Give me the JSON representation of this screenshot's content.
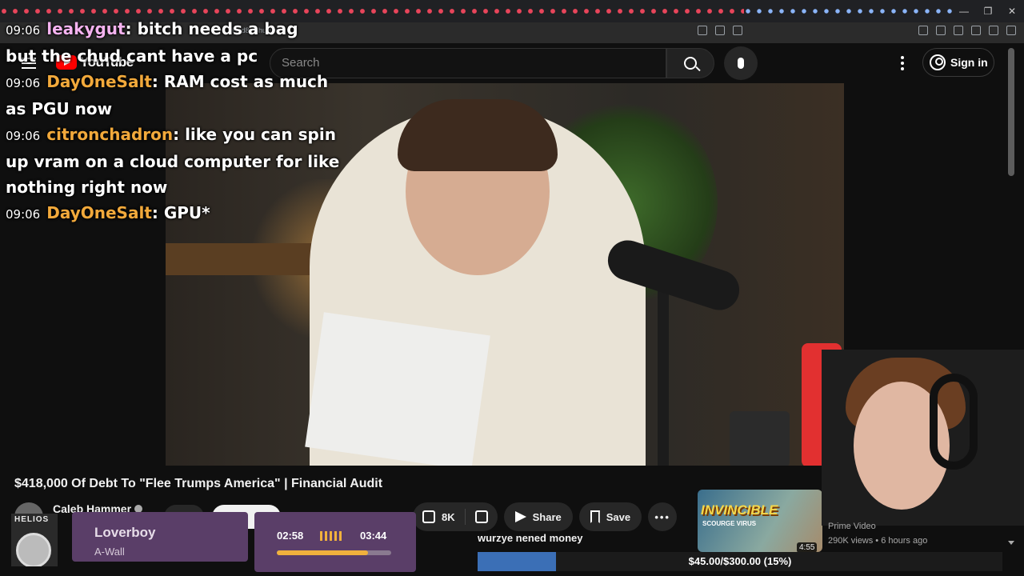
{
  "browser": {
    "url": "Hnd8vGhuyOc"
  },
  "header": {
    "logo_text": "YouTube",
    "search_placeholder": "Search",
    "signin_label": "Sign in"
  },
  "chat": [
    {
      "time": "09:06",
      "user": "leakygut",
      "text": "bitch needs a bag",
      "color": "#f5b3f0"
    },
    {
      "time": "",
      "user": "",
      "text": "but the chud cant have a pc",
      "color": ""
    },
    {
      "time": "09:06",
      "user": "DayOneSalt",
      "text": "RAM cost as much as PGU now",
      "color": "#f2a93b"
    },
    {
      "time": "09:06",
      "user": "citronchadron",
      "text": "like you can spin up vram on a cloud computer for like nothing right now",
      "color": "#f2a93b"
    },
    {
      "time": "09:06",
      "user": "DayOneSalt",
      "text": "GPU*",
      "color": "#f2a93b"
    }
  ],
  "video": {
    "title": "$418,000 Of Debt To \"Flee Trumps America\" | Financial Audit",
    "channel": "Caleb Hammer",
    "likes": "8K",
    "share_label": "Share",
    "save_label": "Save",
    "more_label": "•••"
  },
  "suggested": {
    "title": "INVINCIBLE",
    "subtitle": "SCOURGE VIRUS",
    "duration": "4:55",
    "channel": "Prime Video",
    "meta": "290K views • 6 hours ago"
  },
  "music": {
    "album_logo": "HELIOS",
    "track": "Loverboy",
    "artist": "A-Wall",
    "elapsed": "02:58",
    "total": "03:44",
    "progress": 0.8
  },
  "donation": {
    "message": "wurzye nened money",
    "goal_text": "$45.00/$300.00 (15%)",
    "progress": 0.15
  },
  "colors": {
    "accent": "#ff0000",
    "chat_user": "#f2a93b",
    "widget_bg": "#5a3e68",
    "goal_fill": "#3b6fb6"
  }
}
